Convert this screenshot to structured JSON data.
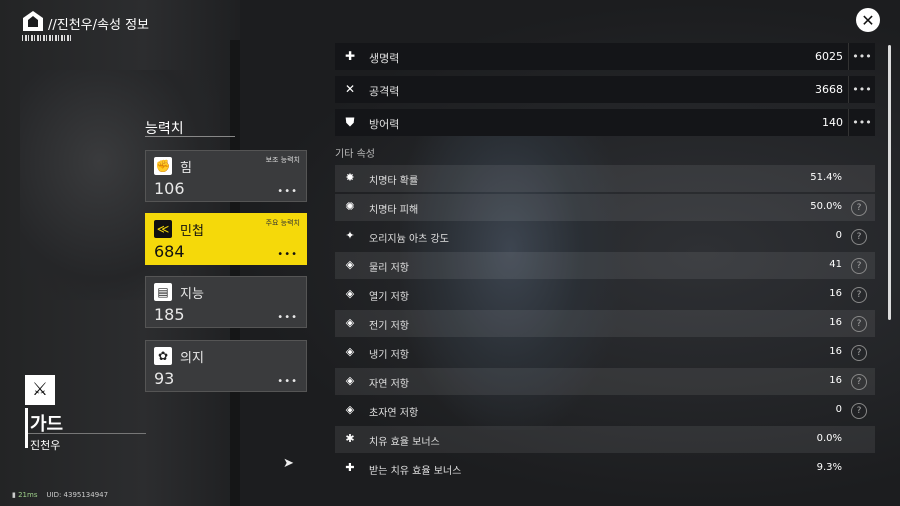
{
  "header": {
    "title": "//진천우/속성 정보"
  },
  "section": {
    "title": "능력치"
  },
  "stat_cards": [
    {
      "name": "힘",
      "tag": "보조 능력치",
      "value": "106",
      "more": "•••",
      "icon": "fist-icon"
    },
    {
      "name": "민첩",
      "tag": "주요 능력치",
      "value": "684",
      "more": "•••",
      "icon": "agility-icon"
    },
    {
      "name": "지능",
      "tag": "",
      "value": "185",
      "more": "•••",
      "icon": "book-icon"
    },
    {
      "name": "의지",
      "tag": "",
      "value": "93",
      "more": "•••",
      "icon": "will-icon"
    }
  ],
  "character": {
    "class": "가드",
    "name": "진천우"
  },
  "footer": {
    "ping": "21ms",
    "uid": "UID: 4395134947"
  },
  "main_stats": [
    {
      "label": "생명력",
      "value": "6025",
      "icon": "health-cross-icon"
    },
    {
      "label": "공격력",
      "value": "3668",
      "icon": "crossed-swords-icon"
    },
    {
      "label": "방어력",
      "value": "140",
      "icon": "shield-icon"
    }
  ],
  "other_title": "기타 속성",
  "other_stats": [
    {
      "label": "치명타 확률",
      "value": "51.4%",
      "help": false,
      "icon": "crit-burst-icon"
    },
    {
      "label": "치명타 피해",
      "value": "50.0%",
      "help": true,
      "icon": "crit-damage-icon"
    },
    {
      "label": "오리지늄 아츠 강도",
      "value": "0",
      "help": true,
      "icon": "arts-icon"
    },
    {
      "label": "물리 저항",
      "value": "41",
      "help": true,
      "icon": "physical-res-icon"
    },
    {
      "label": "열기 저항",
      "value": "16",
      "help": true,
      "icon": "heat-res-icon"
    },
    {
      "label": "전기 저항",
      "value": "16",
      "help": true,
      "icon": "electric-res-icon"
    },
    {
      "label": "냉기 저항",
      "value": "16",
      "help": true,
      "icon": "cold-res-icon"
    },
    {
      "label": "자연 저항",
      "value": "16",
      "help": true,
      "icon": "nature-res-icon"
    },
    {
      "label": "초자연 저항",
      "value": "0",
      "help": true,
      "icon": "aether-res-icon"
    },
    {
      "label": "치유 효율 보너스",
      "value": "0.0%",
      "help": false,
      "icon": "heal-bonus-icon"
    },
    {
      "label": "받는 치유 효율 보너스",
      "value": "9.3%",
      "help": false,
      "icon": "received-heal-icon"
    }
  ]
}
